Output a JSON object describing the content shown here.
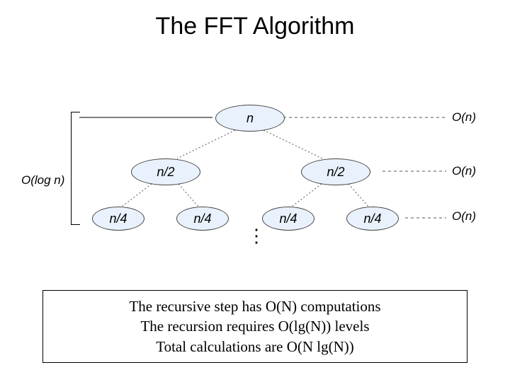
{
  "title": "The FFT Algorithm",
  "nodes": {
    "n": "n",
    "n2a": "n/2",
    "n2b": "n/2",
    "n4a": "n/4",
    "n4b": "n/4",
    "n4c": "n/4",
    "n4d": "n/4"
  },
  "right_labels": {
    "l0": "O(n)",
    "l1": "O(n)",
    "l2": "O(n)"
  },
  "left_label": "O(log n)",
  "ellipsis": "⋮",
  "caption": {
    "line1": "The recursive step has O(N) computations",
    "line2": "The recursion requires O(lg(N)) levels",
    "line3": "Total calculations are O(N lg(N))"
  }
}
